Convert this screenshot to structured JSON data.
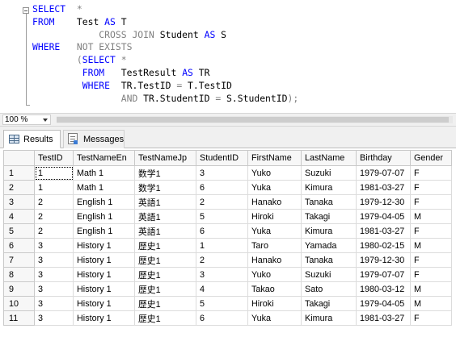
{
  "editor": {
    "lines": [
      [
        {
          "t": "SELECT",
          "c": "kw"
        },
        {
          "t": "  *",
          "c": "gr"
        }
      ],
      [
        {
          "t": "FROM",
          "c": "kw"
        },
        {
          "t": "    Test ",
          "c": "bk"
        },
        {
          "t": "AS",
          "c": "kw"
        },
        {
          "t": " T",
          "c": "bk"
        }
      ],
      [
        {
          "t": "            ",
          "c": "bk"
        },
        {
          "t": "CROSS JOIN",
          "c": "gr"
        },
        {
          "t": " Student ",
          "c": "bk"
        },
        {
          "t": "AS",
          "c": "kw"
        },
        {
          "t": " S",
          "c": "bk"
        }
      ],
      [
        {
          "t": "WHERE",
          "c": "kw"
        },
        {
          "t": "   ",
          "c": "bk"
        },
        {
          "t": "NOT EXISTS",
          "c": "gr"
        }
      ],
      [
        {
          "t": "        ",
          "c": "bk"
        },
        {
          "t": "(",
          "c": "gr"
        },
        {
          "t": "SELECT",
          "c": "kw"
        },
        {
          "t": " *",
          "c": "gr"
        }
      ],
      [
        {
          "t": "         ",
          "c": "bk"
        },
        {
          "t": "FROM",
          "c": "kw"
        },
        {
          "t": "   TestResult ",
          "c": "bk"
        },
        {
          "t": "AS",
          "c": "kw"
        },
        {
          "t": " TR",
          "c": "bk"
        }
      ],
      [
        {
          "t": "         ",
          "c": "bk"
        },
        {
          "t": "WHERE",
          "c": "kw"
        },
        {
          "t": "  TR.TestID ",
          "c": "bk"
        },
        {
          "t": "=",
          "c": "gr"
        },
        {
          "t": " T.TestID",
          "c": "bk"
        }
      ],
      [
        {
          "t": "                ",
          "c": "bk"
        },
        {
          "t": "AND",
          "c": "gr"
        },
        {
          "t": " TR.StudentID ",
          "c": "bk"
        },
        {
          "t": "=",
          "c": "gr"
        },
        {
          "t": " S.StudentID",
          "c": "bk"
        },
        {
          "t": ");",
          "c": "gr"
        }
      ]
    ]
  },
  "zoom": {
    "value": "100 %"
  },
  "tabs": {
    "results_label": "Results",
    "messages_label": "Messages"
  },
  "grid": {
    "columns": [
      "TestID",
      "TestNameEn",
      "TestNameJp",
      "StudentID",
      "FirstName",
      "LastName",
      "Birthday",
      "Gender"
    ],
    "rows": [
      [
        "1",
        "1",
        "Math 1",
        "数学1",
        "3",
        "Yuko",
        "Suzuki",
        "1979-07-07",
        "F"
      ],
      [
        "2",
        "1",
        "Math 1",
        "数学1",
        "6",
        "Yuka",
        "Kimura",
        "1981-03-27",
        "F"
      ],
      [
        "3",
        "2",
        "English 1",
        "英語1",
        "2",
        "Hanako",
        "Tanaka",
        "1979-12-30",
        "F"
      ],
      [
        "4",
        "2",
        "English 1",
        "英語1",
        "5",
        "Hiroki",
        "Takagi",
        "1979-04-05",
        "M"
      ],
      [
        "5",
        "2",
        "English 1",
        "英語1",
        "6",
        "Yuka",
        "Kimura",
        "1981-03-27",
        "F"
      ],
      [
        "6",
        "3",
        "History 1",
        "歴史1",
        "1",
        "Taro",
        "Yamada",
        "1980-02-15",
        "M"
      ],
      [
        "7",
        "3",
        "History 1",
        "歴史1",
        "2",
        "Hanako",
        "Tanaka",
        "1979-12-30",
        "F"
      ],
      [
        "8",
        "3",
        "History 1",
        "歴史1",
        "3",
        "Yuko",
        "Suzuki",
        "1979-07-07",
        "F"
      ],
      [
        "9",
        "3",
        "History 1",
        "歴史1",
        "4",
        "Takao",
        "Sato",
        "1980-03-12",
        "M"
      ],
      [
        "10",
        "3",
        "History 1",
        "歴史1",
        "5",
        "Hiroki",
        "Takagi",
        "1979-04-05",
        "M"
      ],
      [
        "11",
        "3",
        "History 1",
        "歴史1",
        "6",
        "Yuka",
        "Kimura",
        "1981-03-27",
        "F"
      ]
    ]
  }
}
